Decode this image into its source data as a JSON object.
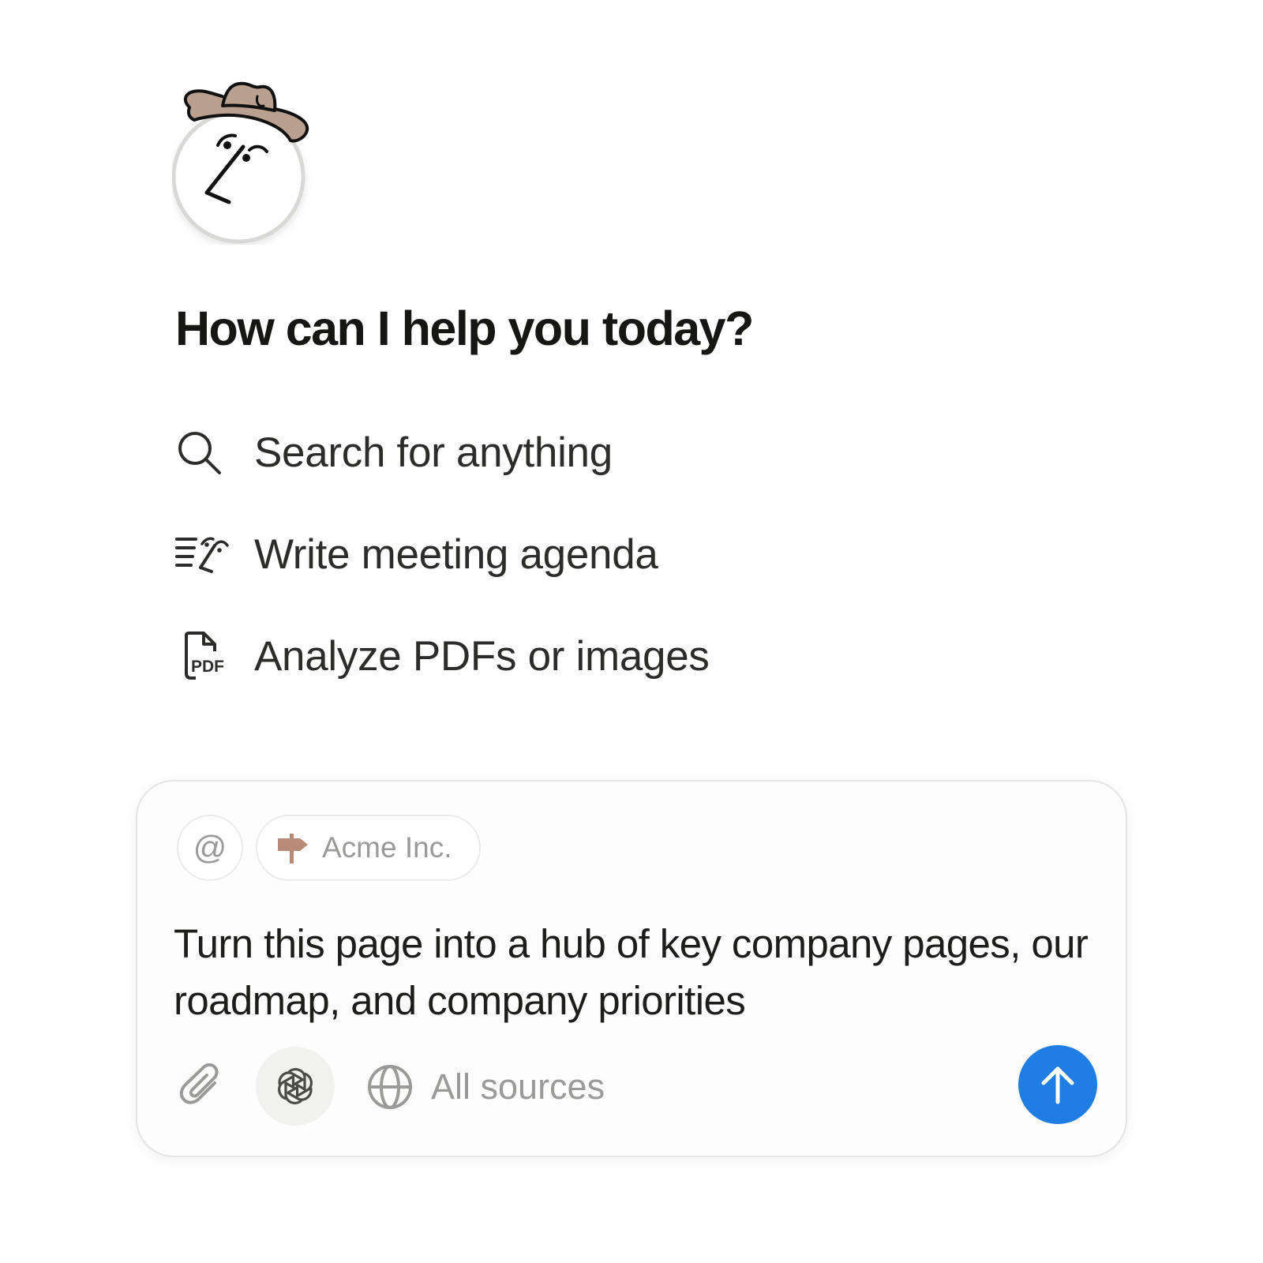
{
  "colors": {
    "accent": "#1f7de4",
    "text": "#1d1d1b",
    "muted": "#9a9a98",
    "hat": "#b9a08f",
    "signpost": "#b88a78"
  },
  "avatar": {
    "icon": "assistant-face-with-cowboy-hat"
  },
  "heading": "How can I help you today?",
  "suggestions": [
    {
      "label": "Search for anything",
      "icon": "search-icon"
    },
    {
      "label": "Write meeting agenda",
      "icon": "writing-icon"
    },
    {
      "label": "Analyze PDFs or images",
      "icon": "pdf-icon"
    }
  ],
  "composer": {
    "mention_symbol": "@",
    "context_chip": {
      "label": "Acme Inc.",
      "icon": "signpost-icon"
    },
    "prompt_text": "Turn this page into a hub of key company pages, our roadmap, and company priorities",
    "toolbar": {
      "attach_icon": "paperclip-icon",
      "model_icon": "openai-icon",
      "sources_icon": "globe-icon",
      "sources_label": "All sources",
      "send_icon": "arrow-up-icon"
    }
  }
}
